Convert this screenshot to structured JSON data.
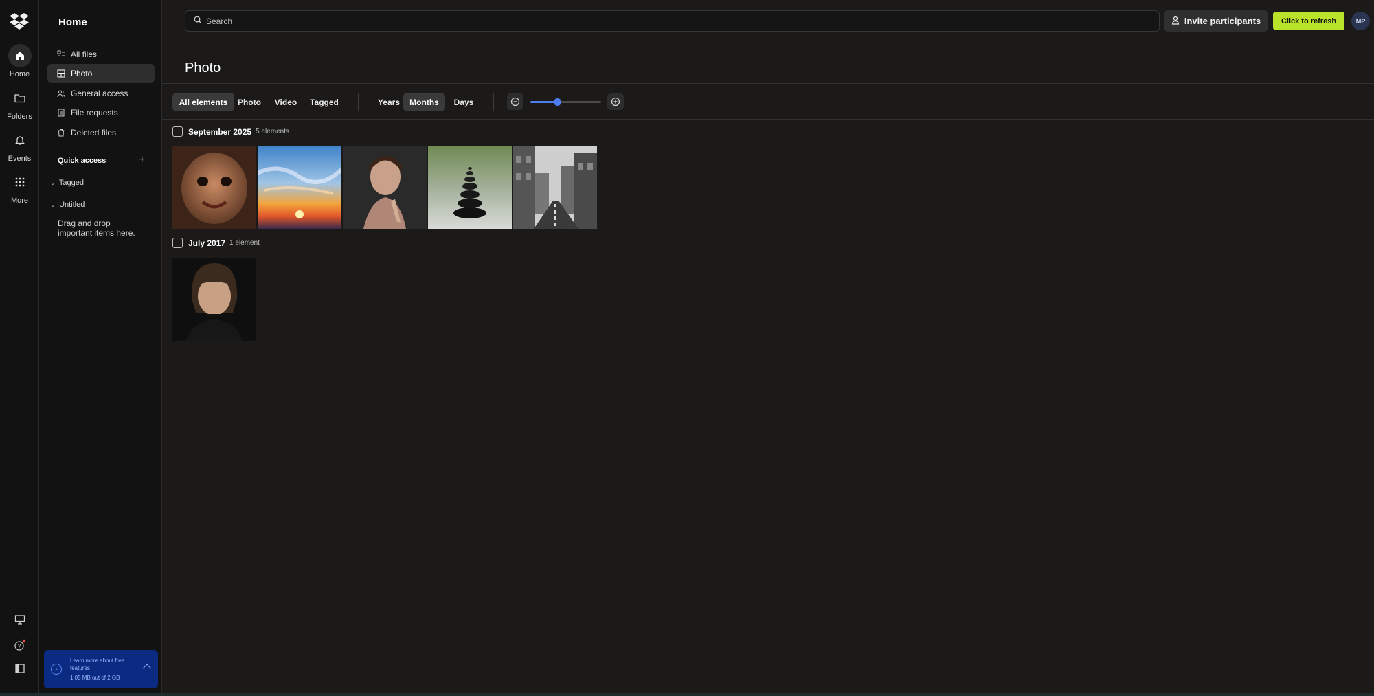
{
  "rail": {
    "home": "Home",
    "folders": "Folders",
    "events": "Events",
    "more": "More"
  },
  "sidebar": {
    "title": "Home",
    "items": [
      {
        "label": "All files",
        "icon": "all-files-icon"
      },
      {
        "label": "Photo",
        "icon": "photo-icon",
        "active": true
      },
      {
        "label": "General access",
        "icon": "shared-icon"
      },
      {
        "label": "File requests",
        "icon": "file-request-icon"
      },
      {
        "label": "Deleted files",
        "icon": "trash-icon"
      }
    ],
    "quick_access": {
      "title": "Quick access",
      "sections": [
        "Tagged",
        "Untitled"
      ],
      "hint": "Drag and drop important items here."
    },
    "promo": {
      "line1": "Learn more about free features",
      "line2": "1.05 MB out of 2 GB"
    }
  },
  "header": {
    "search_placeholder": "Search",
    "invite": "Invite participants",
    "refresh": "Click to refresh",
    "avatar": "MP"
  },
  "page": {
    "title": "Photo",
    "filters": [
      "All elements",
      "Photo",
      "Video",
      "Tagged"
    ],
    "active_filter": "All elements",
    "time_scales": [
      "Years",
      "Months",
      "Days"
    ],
    "active_time_scale": "Months",
    "zoom_level": 0.38
  },
  "groups": [
    {
      "title": "September 2025",
      "count": "5 elements",
      "photos": [
        "baby-portrait",
        "sunset-sky",
        "woman-portrait",
        "stacked-stones",
        "city-street-bw"
      ]
    },
    {
      "title": "July 2017",
      "count": "1 element",
      "photos": [
        "girl-portrait"
      ]
    }
  ],
  "colors": {
    "accent": "#4d7df0",
    "refresh_bg": "#b8e32a",
    "promo_bg": "#0b2a82",
    "background": "#1b1a19"
  }
}
